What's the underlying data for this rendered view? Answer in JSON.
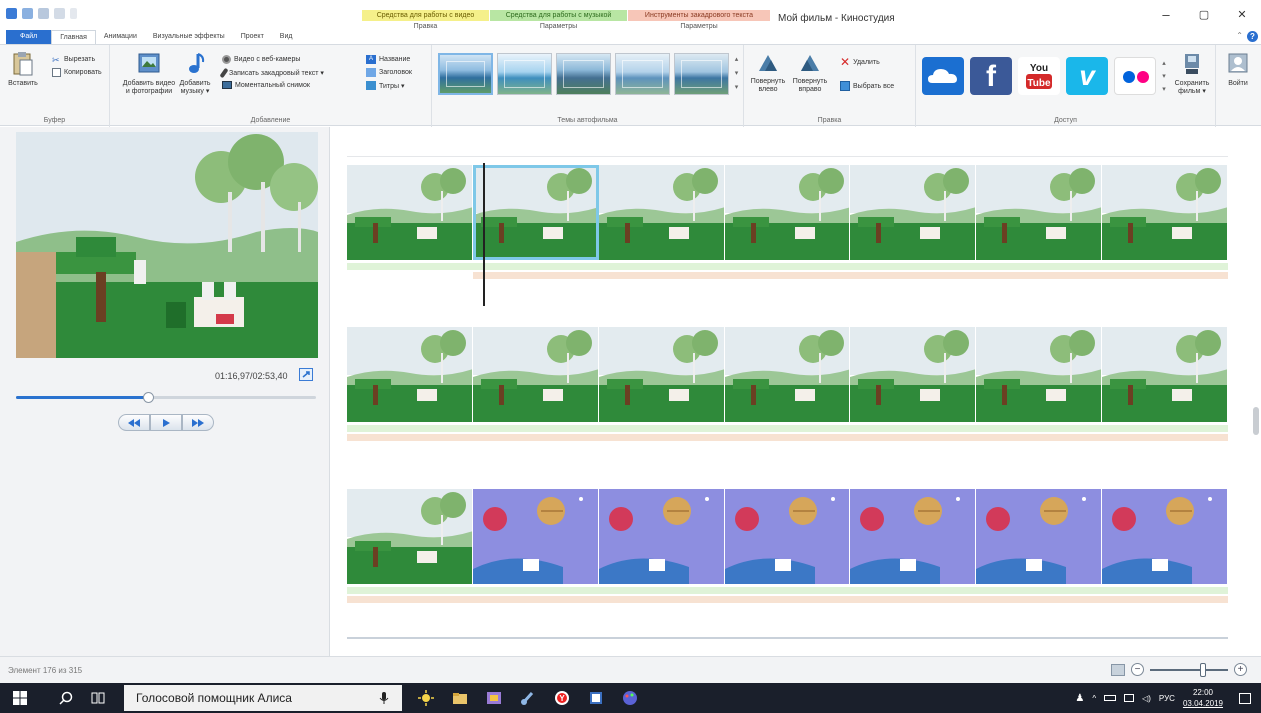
{
  "window": {
    "title": "Мой фильм - Киностудия",
    "minimize": "–",
    "maximize": "▢",
    "close": "✕"
  },
  "context_tabs": [
    {
      "title": "Средства для работы с видео",
      "sub": "Правка"
    },
    {
      "title": "Средства для работы с музыкой",
      "sub": "Параметры"
    },
    {
      "title": "Инструменты закадрового текста",
      "sub": "Параметры"
    }
  ],
  "tabs": [
    "Файл",
    "Главная",
    "Анимации",
    "Визуальные эффекты",
    "Проект",
    "Вид"
  ],
  "ribbon": {
    "clipboard": {
      "label": "Буфер",
      "paste": "Вставить",
      "cut": "Вырезать",
      "copy": "Копировать"
    },
    "add": {
      "label": "Добавление",
      "add_video_1": "Добавить видео",
      "add_video_2": "и фотографии",
      "add_music_1": "Добавить",
      "add_music_2": "музыку ▾",
      "webcam": "Видео с веб-камеры",
      "narration": "Записать закадровый текст ▾",
      "snapshot": "Моментальный снимок",
      "caption": "Название",
      "title": "Заголовок",
      "credits": "Титры ▾"
    },
    "themes": {
      "label": "Темы автофильма"
    },
    "edit": {
      "label": "Правка",
      "rotate_left_1": "Повернуть",
      "rotate_left_2": "влево",
      "rotate_right_1": "Повернуть",
      "rotate_right_2": "вправо",
      "delete": "Удалить",
      "select_all": "Выбрать все"
    },
    "share": {
      "label": "Доступ",
      "save_1": "Сохранить",
      "save_2": "фильм ▾",
      "signin": "Войти"
    }
  },
  "preview": {
    "time": "01:16,97/02:53,40",
    "seek_fraction": 0.44
  },
  "status": {
    "element": "Элемент 176 из 315",
    "zoom_fraction": 0.68
  },
  "taskbar": {
    "search": "Голосовой помощник Алиса",
    "lang": "РУС",
    "time": "22:00",
    "date": "03.04.2019"
  },
  "colors": {
    "accent": "#2a6fcf",
    "selection": "#7ec8e8",
    "music_track": "#dff3d8",
    "narration_track": "#f7e2d2"
  }
}
